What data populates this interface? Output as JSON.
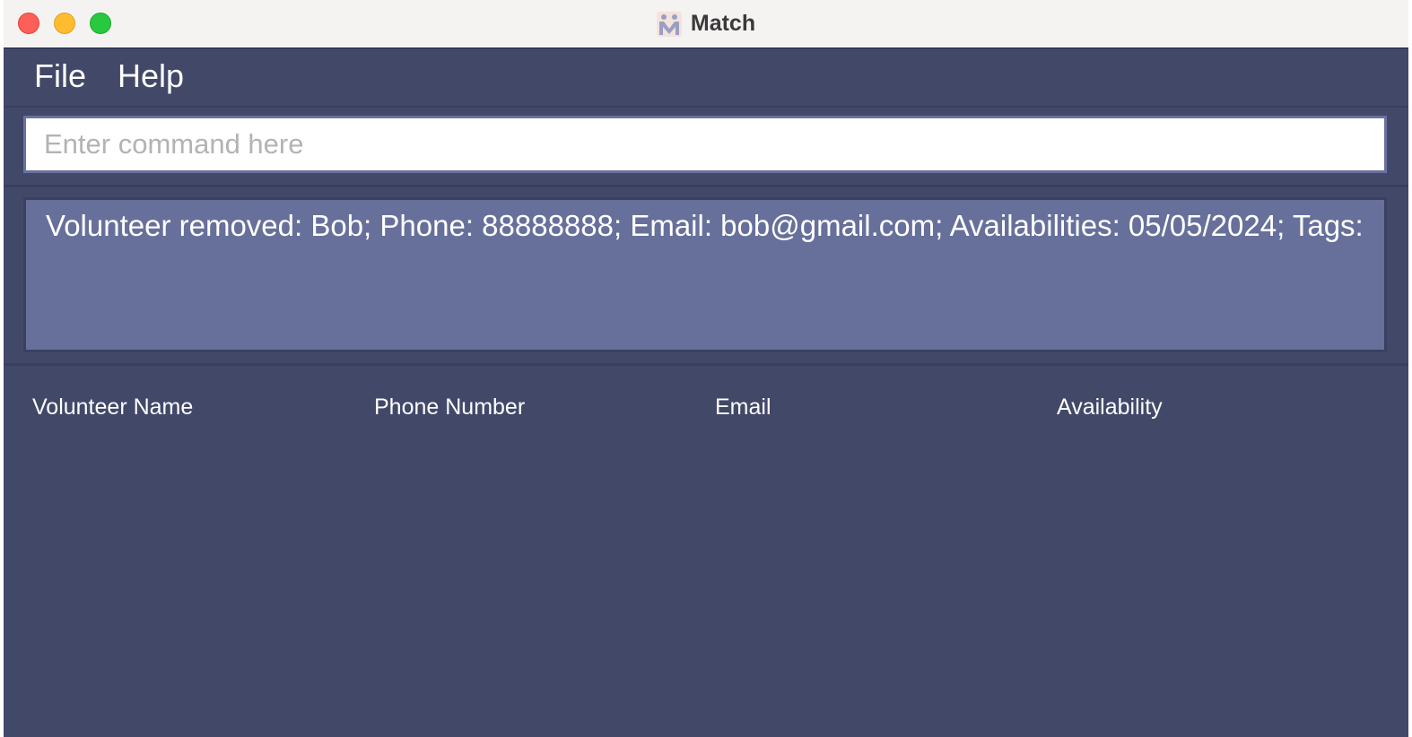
{
  "window": {
    "title": "Match",
    "app_icon": "match-app-icon"
  },
  "menu": {
    "items": [
      {
        "label": "File"
      },
      {
        "label": "Help"
      }
    ]
  },
  "command": {
    "placeholder": "Enter command here",
    "value": ""
  },
  "result": {
    "message": "Volunteer removed: Bob; Phone: 88888888; Email: bob@gmail.com; Availabilities: 05/05/2024; Tags:"
  },
  "list": {
    "columns": [
      {
        "label": "Volunteer Name"
      },
      {
        "label": "Phone Number"
      },
      {
        "label": "Email"
      },
      {
        "label": "Availability"
      }
    ],
    "rows": []
  },
  "colors": {
    "background": "#424868",
    "result_background": "#67709b",
    "titlebar": "#f5f3f2",
    "close": "#fe5f57",
    "minimize": "#febc2e",
    "zoom": "#28c840"
  }
}
